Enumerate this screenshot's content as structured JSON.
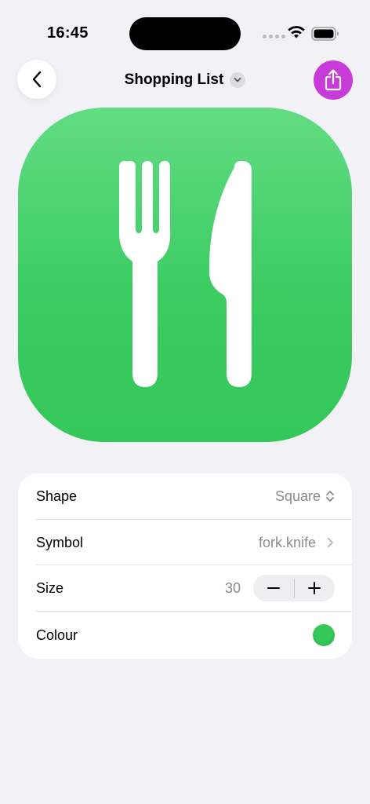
{
  "status_bar": {
    "time": "16:45",
    "icons": [
      "cellular-signal-icon",
      "wifi-icon",
      "battery-icon"
    ]
  },
  "nav": {
    "title": "Shopping List",
    "back_icon": "chevron-left-icon",
    "title_menu_icon": "chevron-down-icon",
    "share_icon": "share-icon",
    "share_color": "#c93bd9"
  },
  "preview": {
    "symbol_icon": "fork-knife-icon",
    "background_color": "#34c759",
    "symbol_color": "#ffffff"
  },
  "settings": {
    "shape": {
      "label": "Shape",
      "value": "Square",
      "icon": "chevron-up-down-icon"
    },
    "symbol": {
      "label": "Symbol",
      "value": "fork.knife",
      "icon": "chevron-right-icon"
    },
    "size": {
      "label": "Size",
      "value": "30",
      "decrement_icon": "minus-icon",
      "increment_icon": "plus-icon"
    },
    "colour": {
      "label": "Colour",
      "value": "#34c759"
    }
  }
}
